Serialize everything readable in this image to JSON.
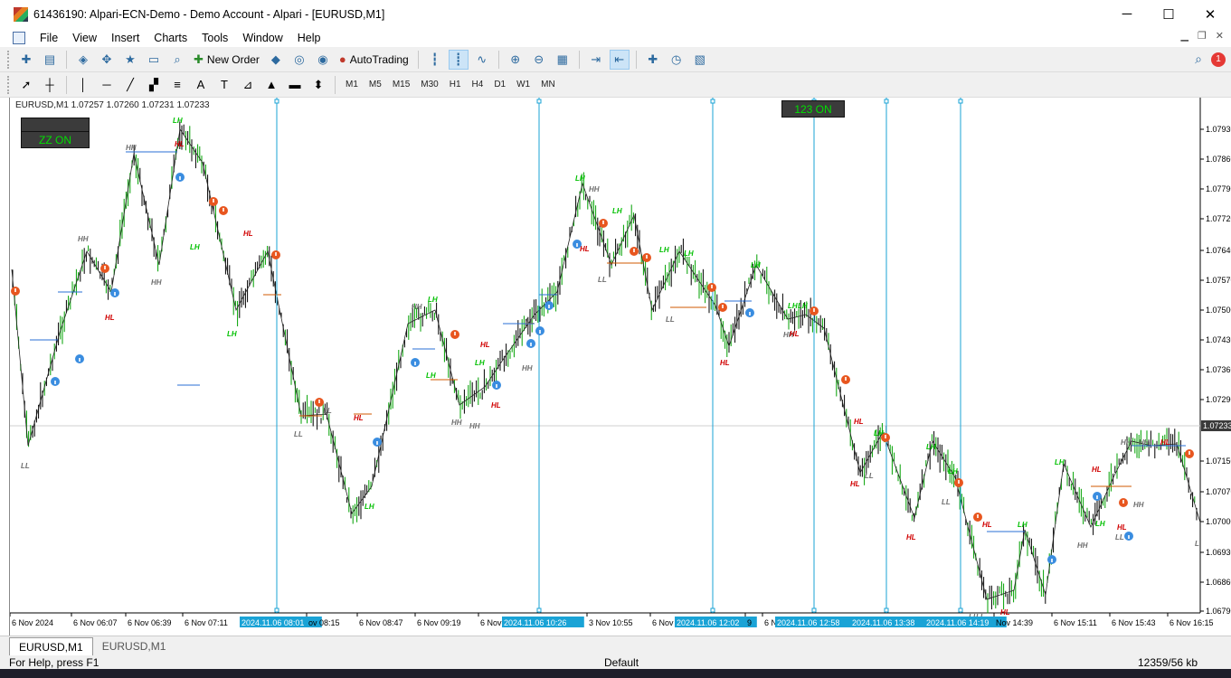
{
  "window": {
    "title": "61436190: Alpari-ECN-Demo - Demo Account - Alpari - [EURUSD,M1]",
    "controls": [
      "─",
      "☐",
      "✕"
    ]
  },
  "menu": [
    "File",
    "View",
    "Insert",
    "Charts",
    "Tools",
    "Window",
    "Help"
  ],
  "toolbar": {
    "new_order": "New Order",
    "autotrading": "AutoTrading",
    "notification_count": "1"
  },
  "timeframes": [
    "M1",
    "M5",
    "M15",
    "M30",
    "H1",
    "H4",
    "D1",
    "W1",
    "MN"
  ],
  "chart": {
    "symbol_info": "EURUSD,M1  1.07257 1.07260 1.07231 1.07233",
    "zz_button": "ZZ ON",
    "button_123": "123 ON",
    "current_price": "1.07233",
    "price_labels": [
      "1.07930",
      "1.07860",
      "1.07790",
      "1.07720",
      "1.07640",
      "1.07570",
      "1.07500",
      "1.07430",
      "1.07360",
      "1.07290",
      "1.07150",
      "1.07070",
      "1.07000",
      "1.06930",
      "1.06860",
      "1.06790"
    ],
    "time_labels": [
      {
        "t": "6 Nov 2024",
        "hl": false
      },
      {
        "t": "6 Nov 06:07",
        "hl": false
      },
      {
        "t": "6 Nov 06:39",
        "hl": false
      },
      {
        "t": "6 Nov 07:11",
        "hl": false
      },
      {
        "t": "2024.11.06 08:01",
        "hl": true
      },
      {
        "t": "ov 08:15",
        "hl": false
      },
      {
        "t": "6 Nov 08:47",
        "hl": false
      },
      {
        "t": "6 Nov 09:19",
        "hl": false
      },
      {
        "t": "6 Nov",
        "hl": false
      },
      {
        "t": "2024.11.06 10:26",
        "hl": true
      },
      {
        "t": "3 Nov 10:55",
        "hl": false
      },
      {
        "t": "6 Nov",
        "hl": false
      },
      {
        "t": "2024.11.06 12:02",
        "hl": true
      },
      {
        "t": "9",
        "hl": false
      },
      {
        "t": "6 N",
        "hl": false
      },
      {
        "t": "2024.11.06 12:58",
        "hl": true
      },
      {
        "t": "2024.11.06 13:38",
        "hl": true
      },
      {
        "t": "2024.11.06 14:19",
        "hl": true
      },
      {
        "t": "Nov 14:39",
        "hl": false
      },
      {
        "t": "6 Nov 15:11",
        "hl": false
      },
      {
        "t": "6 Nov 15:43",
        "hl": false
      },
      {
        "t": "6 Nov 16:15",
        "hl": false
      }
    ],
    "swing_labels": [
      "LL",
      "HH",
      "LH",
      "HL",
      "HH",
      "HH",
      "LH",
      "HL",
      "LH",
      "HL",
      "LL",
      "HH",
      "LH",
      "LL",
      "HL",
      "LH",
      "HH",
      "HH",
      "HL",
      "LH",
      "LH",
      "LL",
      "HL",
      "HH",
      "LH",
      "HH",
      "HL",
      "LH",
      "LL",
      "LH",
      "LH",
      "LL",
      "HL",
      "LH",
      "LH",
      "LH",
      "HH",
      "HL",
      "HL",
      "LH",
      "LL",
      "HL",
      "LH",
      "HL",
      "LL",
      "LH",
      "HL",
      "LL",
      "LH",
      "HL",
      "LH",
      "HH",
      "HL",
      "LH",
      "HL",
      "LL",
      "HH",
      "HH",
      "HH",
      "HL",
      "L",
      "LL"
    ],
    "colors": {
      "bull": "#00a000",
      "bear": "#000000",
      "vline": "#1aa3d6",
      "hh": "#6e6e6e",
      "lh": "#00c000",
      "hl": "#d00000",
      "ll": "#6e6e6e",
      "level": "#2a6fd6",
      "levelDown": "#d25a00"
    }
  },
  "tabs": [
    "EURUSD,M1",
    "EURUSD,M1"
  ],
  "status": {
    "help": "For Help, press F1",
    "profile": "Default",
    "traffic": "12359/56 kb"
  }
}
